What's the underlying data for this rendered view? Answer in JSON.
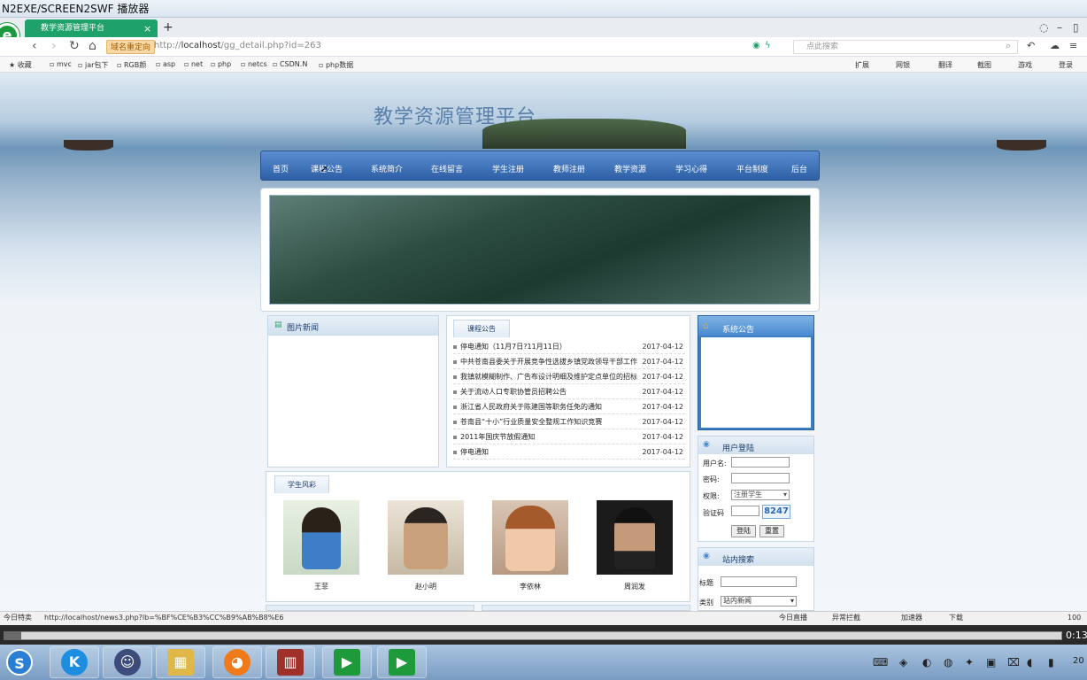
{
  "player": {
    "title": "N2EXE/SCREEN2SWF 播放器",
    "timecode": "0:13",
    "clock": "20"
  },
  "browser": {
    "logo": "e",
    "tab_title": "教学资源管理平台",
    "tab_close": "×",
    "tab_add": "+",
    "site_badge": "域名重定向",
    "url_prefix": "http://",
    "url_host": "localhost",
    "url_path": "/gg_detail.php?id=263",
    "search_placeholder": "点此搜索",
    "bookmarks": [
      "收藏",
      "mvc",
      "jar包下",
      "RGB颜",
      "asp",
      "net",
      "php",
      "netcs",
      "CSDN.N",
      "php数据"
    ],
    "right_tools": [
      "扩展",
      "网银",
      "翻译",
      "截图",
      "游戏",
      "登录"
    ],
    "status_left": "今日特卖",
    "status_url": "http://localhost/news3.php?lb=%BF%CE%B3%CC%B9%AB%B8%E6",
    "status_right": [
      "今日直播",
      "异常拦截",
      "加速器",
      "下载",
      "100"
    ]
  },
  "site": {
    "title": "教学资源管理平台",
    "nav": [
      "首页",
      "课程公告",
      "系统简介",
      "在线留言",
      "学生注册",
      "教师注册",
      "教学资源",
      "学习心得",
      "平台制度",
      "后台"
    ],
    "photo_news_title": "图片新闻",
    "course_notice_tab": "课程公告",
    "news": [
      {
        "title": "停电通知（11月7日?11月11日）",
        "date": "2017-04-12"
      },
      {
        "title": "中共苍南县委关于开展竞争性选拔乡镇党政领导干部工作",
        "date": "2017-04-12"
      },
      {
        "title": "我镇就模糊制作、广告布设计明细及维护定点单位的招标",
        "date": "2017-04-12"
      },
      {
        "title": "关于流动人口专职协管员招聘公告",
        "date": "2017-04-12"
      },
      {
        "title": "浙江省人民政府关于陈建国等职务任免的通知",
        "date": "2017-04-12"
      },
      {
        "title": "苍南县“十小”行业质量安全整规工作知识竞赛",
        "date": "2017-04-12"
      },
      {
        "title": "2011年国庆节放假通知",
        "date": "2017-04-12"
      },
      {
        "title": "停电通知",
        "date": "2017-04-12"
      }
    ],
    "student_tab": "学生风彩",
    "students": [
      "王菲",
      "赵小明",
      "李依林",
      "周润发"
    ],
    "system_notice_title": "系统公告",
    "login": {
      "title": "用户登陆",
      "user_label": "用户名:",
      "pwd_label": "密码:",
      "role_label": "权限:",
      "role_value": "注册学生",
      "captcha_label": "验证码",
      "captcha": "8247",
      "login_btn": "登陆",
      "reset_btn": "重置"
    },
    "search": {
      "title": "站内搜索",
      "title_label": "标题",
      "type_label": "类别",
      "type_value": "站内新闻"
    }
  },
  "colors": {
    "tab_green": "#1fa16b",
    "nav_blue": "#2e5fa6",
    "panel_blue": "#1b3d6e",
    "captcha_blue": "#2a66b8"
  }
}
